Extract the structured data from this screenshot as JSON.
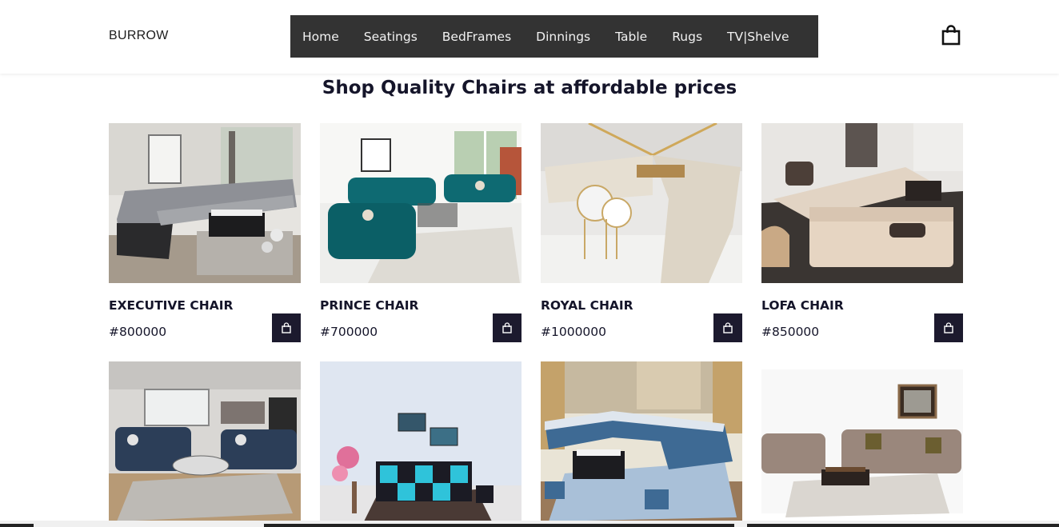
{
  "header": {
    "brand": "BURROW",
    "nav": [
      "Home",
      "Seatings",
      "BedFrames",
      "Dinnings",
      "Table",
      "Rugs",
      "TV|Shelve"
    ],
    "cart_icon": "shopping-bag-icon"
  },
  "main": {
    "title": "Shop Quality Chairs at affordable prices",
    "products": [
      {
        "name": "EXECUTIVE CHAIR",
        "price": "#800000",
        "photo": "grey-sectional-sofa"
      },
      {
        "name": "PRINCE CHAIR",
        "price": "#700000",
        "photo": "teal-tufted-sofa-set"
      },
      {
        "name": "ROYAL CHAIR",
        "price": "#1000000",
        "photo": "cream-marble-sectional"
      },
      {
        "name": "LOFA CHAIR",
        "price": "#850000",
        "photo": "beige-modern-sectional"
      },
      {
        "name": "",
        "price": "",
        "photo": "navy-sofa-living-room"
      },
      {
        "name": "",
        "price": "",
        "photo": "cyan-black-checker-sofa"
      },
      {
        "name": "",
        "price": "",
        "photo": "blue-u-shaped-sectional"
      },
      {
        "name": "",
        "price": "",
        "photo": "taupe-sofa-set"
      }
    ],
    "buy_icon": "shopping-bag-icon"
  },
  "colors": {
    "nav_bg": "#333333",
    "buy_button_bg": "#1c1a2e",
    "text": "#15152a"
  }
}
